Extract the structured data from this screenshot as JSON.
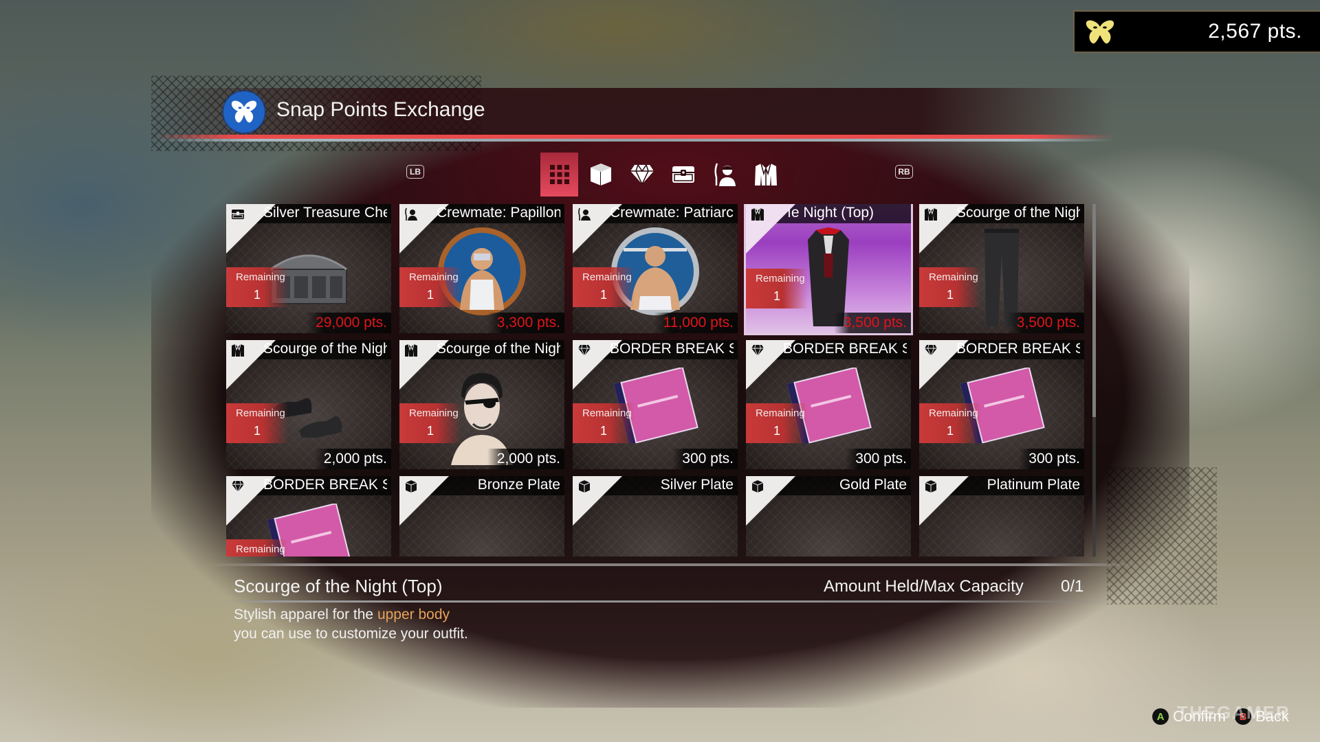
{
  "header": {
    "title": "Snap Points Exchange",
    "title_icon": "butterfly-icon",
    "points": "2,567 pts.",
    "points_icon": "butterfly-icon"
  },
  "tabs": {
    "prev_button": "LB",
    "next_button": "RB",
    "items": [
      {
        "name": "all",
        "icon": "grid-icon",
        "selected": true
      },
      {
        "name": "items",
        "icon": "box-icon",
        "selected": false
      },
      {
        "name": "valuables",
        "icon": "diamond-icon",
        "selected": false
      },
      {
        "name": "treasure",
        "icon": "chest-icon",
        "selected": false
      },
      {
        "name": "crewmates",
        "icon": "crewmate-icon",
        "selected": false
      },
      {
        "name": "outfits",
        "icon": "jacket-icon",
        "selected": false
      }
    ]
  },
  "colors": {
    "accent_red": "#e94b4b",
    "selected_tab": "#e64a5f",
    "price_unaffordable": "#e0151b",
    "price_affordable": "#ffffff",
    "remaining_badge": "#c93a3a",
    "description_highlight": "#e8a25b",
    "points_icon": "#f0e27a",
    "title_icon_bg": "#1f63c4"
  },
  "grid": {
    "remaining_label": "Remaining",
    "items": [
      {
        "name": "Silver Treasure Chest",
        "display_name": "Silver Treasure Ches",
        "category_icon": "chest-icon",
        "art": "treasure-chest",
        "remaining": "1",
        "price": "29,000 pts.",
        "affordable": false,
        "selected": false
      },
      {
        "name": "Crewmate: Papillon",
        "display_name": "Crewmate: Papillon I",
        "category_icon": "crewmate-icon",
        "art": "crewmate-portrait-bronze",
        "remaining": "1",
        "price": "3,300 pts.",
        "affordable": false,
        "selected": false
      },
      {
        "name": "Crewmate: Patriarch",
        "display_name": "Crewmate: Patriarch",
        "category_icon": "crewmate-icon",
        "art": "crewmate-portrait-silver",
        "remaining": "1",
        "price": "11,000 pts.",
        "affordable": false,
        "selected": false
      },
      {
        "name": "Scourge of the Night (Top)",
        "display_name": "ıe Night (Top)",
        "category_icon": "jacket-icon",
        "art": "coat",
        "remaining": "1",
        "price": "3,500 pts.",
        "affordable": false,
        "selected": true
      },
      {
        "name": "Scourge of the Night",
        "display_name": "Scourge of the Night",
        "category_icon": "jacket-icon",
        "art": "pants",
        "remaining": "1",
        "price": "3,500 pts.",
        "affordable": false,
        "selected": false
      },
      {
        "name": "Scourge of the Night",
        "display_name": "Scourge of the Night",
        "category_icon": "jacket-icon",
        "art": "shoes",
        "remaining": "1",
        "price": "2,000 pts.",
        "affordable": true,
        "selected": false
      },
      {
        "name": "Scourge of the Night",
        "display_name": "Scourge of the Night",
        "category_icon": "jacket-icon",
        "art": "head",
        "remaining": "1",
        "price": "2,000 pts.",
        "affordable": true,
        "selected": false
      },
      {
        "name": "BORDER BREAK Soundtrack",
        "display_name": "BORDER BREAK Sour",
        "category_icon": "diamond-icon",
        "art": "cd-case",
        "remaining": "1",
        "price": "300 pts.",
        "affordable": true,
        "selected": false
      },
      {
        "name": "BORDER BREAK Soundtrack",
        "display_name": "BORDER BREAK Sour",
        "category_icon": "diamond-icon",
        "art": "cd-case",
        "remaining": "1",
        "price": "300 pts.",
        "affordable": true,
        "selected": false
      },
      {
        "name": "BORDER BREAK Soundtrack",
        "display_name": "BORDER BREAK Sour",
        "category_icon": "diamond-icon",
        "art": "cd-case",
        "remaining": "1",
        "price": "300 pts.",
        "affordable": true,
        "selected": false
      },
      {
        "name": "BORDER BREAK Soundtrack",
        "display_name": "BORDER BREAK Sour",
        "category_icon": "diamond-icon",
        "art": "cd-case",
        "remaining": "",
        "price": "",
        "affordable": true,
        "selected": false
      },
      {
        "name": "Bronze Plate",
        "display_name": "Bronze Plate",
        "category_icon": "box-icon",
        "art": "plate-bronze",
        "remaining": null,
        "price": "",
        "affordable": true,
        "selected": false
      },
      {
        "name": "Silver Plate",
        "display_name": "Silver Plate",
        "category_icon": "box-icon",
        "art": "plate-silver",
        "remaining": null,
        "price": "",
        "affordable": true,
        "selected": false
      },
      {
        "name": "Gold Plate",
        "display_name": "Gold Plate",
        "category_icon": "box-icon",
        "art": "plate-gold",
        "remaining": null,
        "price": "",
        "affordable": true,
        "selected": false
      },
      {
        "name": "Platinum Plate",
        "display_name": "Platinum Plate",
        "category_icon": "box-icon",
        "art": "plate-platinum",
        "remaining": null,
        "price": "",
        "affordable": true,
        "selected": false
      }
    ]
  },
  "detail": {
    "title": "Scourge of the Night (Top)",
    "description_before": "Stylish apparel for the ",
    "description_highlight": "upper body",
    "description_after": "you can use to customize your outfit.",
    "capacity_label": "Amount Held/Max Capacity",
    "capacity_value": "0/1"
  },
  "footer": {
    "confirm": {
      "button": "A",
      "label": "Confirm"
    },
    "back": {
      "button": "B",
      "label": "Back"
    },
    "watermark": "THEGAMER"
  }
}
